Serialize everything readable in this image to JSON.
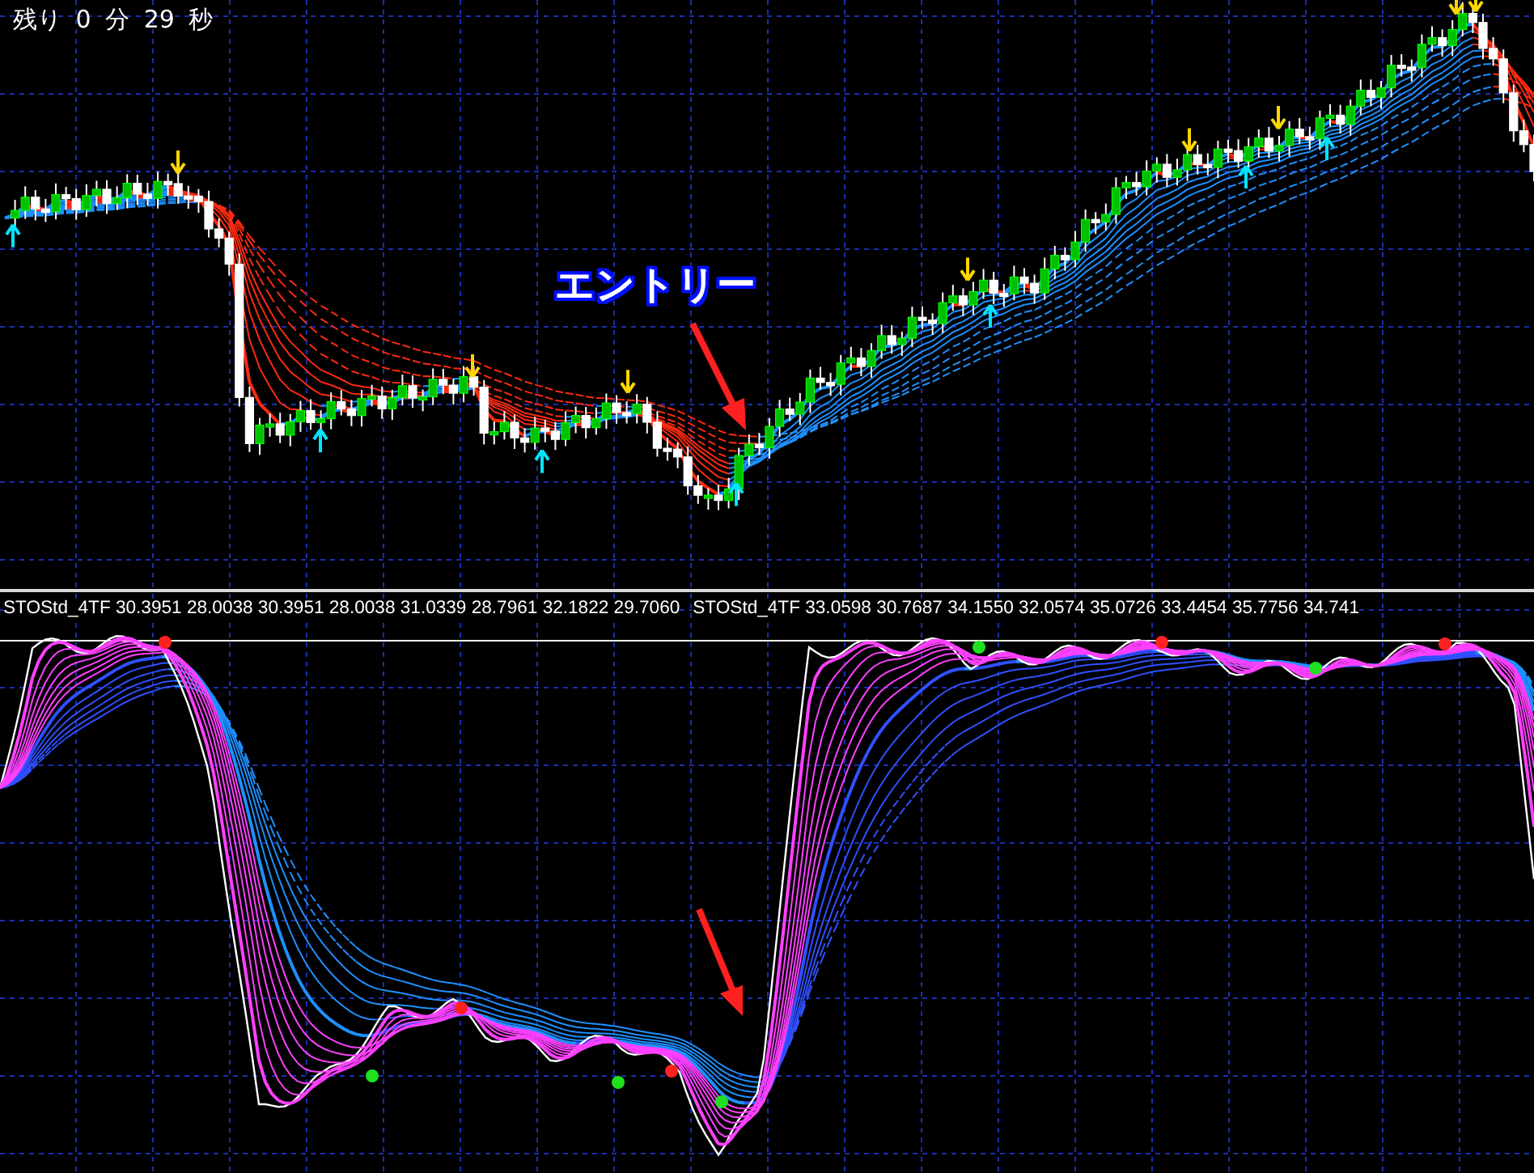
{
  "timer": {
    "text": "残り 0 分 29 秒"
  },
  "price_chart": {
    "annotation": "エントリー"
  },
  "indicator": {
    "labels": [
      "STOStd_4TF 30.3951 28.0038 30.3951 28.0038 31.0339 28.7961 32.1822 29.7060",
      "STOStd_4TF 33.0598 30.7687 34.1550 32.0574 35.0726 33.4454 35.7756 34.741"
    ]
  }
}
